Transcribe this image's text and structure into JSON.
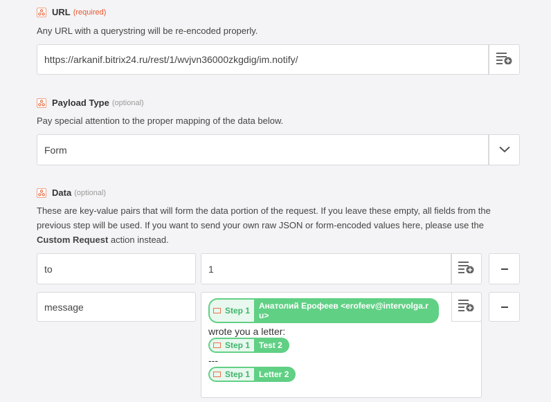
{
  "url_field": {
    "label": "URL",
    "badge": "(required)",
    "help": "Any URL with a querystring will be re-encoded properly.",
    "value": "https://arkanif.bitrix24.ru/rest/1/wvjvn36000zkgdig/im.notify/"
  },
  "payload_field": {
    "label": "Payload Type",
    "badge": "(optional)",
    "help": "Pay special attention to the proper mapping of the data below.",
    "value": "Form"
  },
  "data_field": {
    "label": "Data",
    "badge": "(optional)",
    "help_line1": "These are key-value pairs that will form the data portion of the request. If you leave these empty, all fields from the",
    "help_line2": "previous step will be used. If you want to send your own raw JSON or form-encoded values here, please use the",
    "help_bold": "Custom Request",
    "help_tail": " action instead.",
    "rows": [
      {
        "key": "to",
        "value": "1"
      },
      {
        "key": "message"
      }
    ],
    "message_value": {
      "pill1_step": "Step 1",
      "pill1_text_line1": "Анатолий Ерофеев <erofeev@intervolga.r",
      "pill1_text_line2": "u>",
      "text1": "wrote you a letter:",
      "pill2_step": "Step 1",
      "pill2_text": "Test 2",
      "text2": "---",
      "pill3_step": "Step 1",
      "pill3_text": "Letter 2"
    }
  },
  "colors": {
    "accent": "#e8552b",
    "pill_green": "#60d084"
  }
}
